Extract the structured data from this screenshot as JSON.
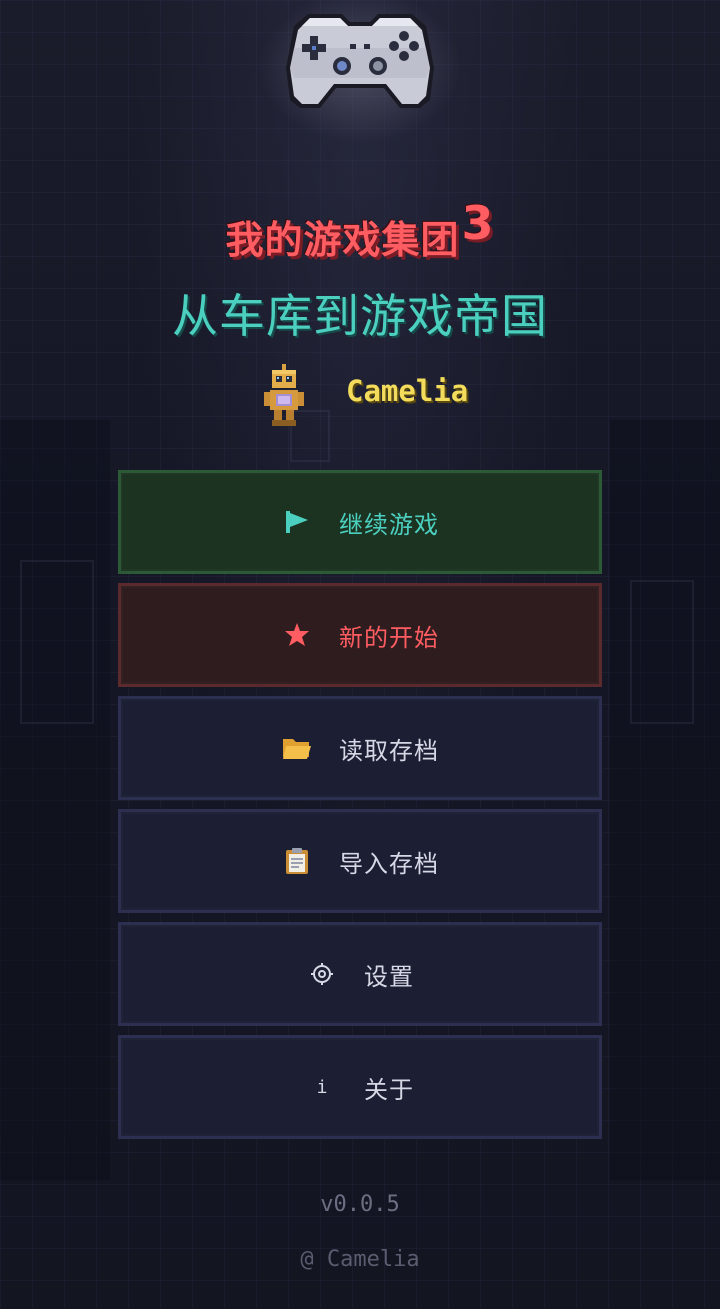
{
  "app": {
    "title_main": "我的游戏集团",
    "title_main_sup": "3",
    "title_sub": "从车库到游戏帝国",
    "player_name": "Camelia"
  },
  "menu": {
    "items": [
      {
        "label": "继续游戏",
        "icon": "play-flag-icon"
      },
      {
        "label": "新的开始",
        "icon": "star-icon"
      },
      {
        "label": "读取存档",
        "icon": "folder-icon"
      },
      {
        "label": "导入存档",
        "icon": "clipboard-icon"
      },
      {
        "label": "设置",
        "icon": "gear-icon"
      },
      {
        "label": "关于",
        "icon": "info-icon"
      }
    ]
  },
  "footer": {
    "version": "v0.0.5",
    "copyright": "@ Camelia"
  },
  "colors": {
    "background": "#141624",
    "title_red": "#ff5d62",
    "title_teal": "#4bd0c0",
    "player_gold": "#f3dc5c",
    "continue_bg": "#1d3322",
    "newgame_bg": "#2f1c1e",
    "button_bg": "#1c1e33"
  }
}
